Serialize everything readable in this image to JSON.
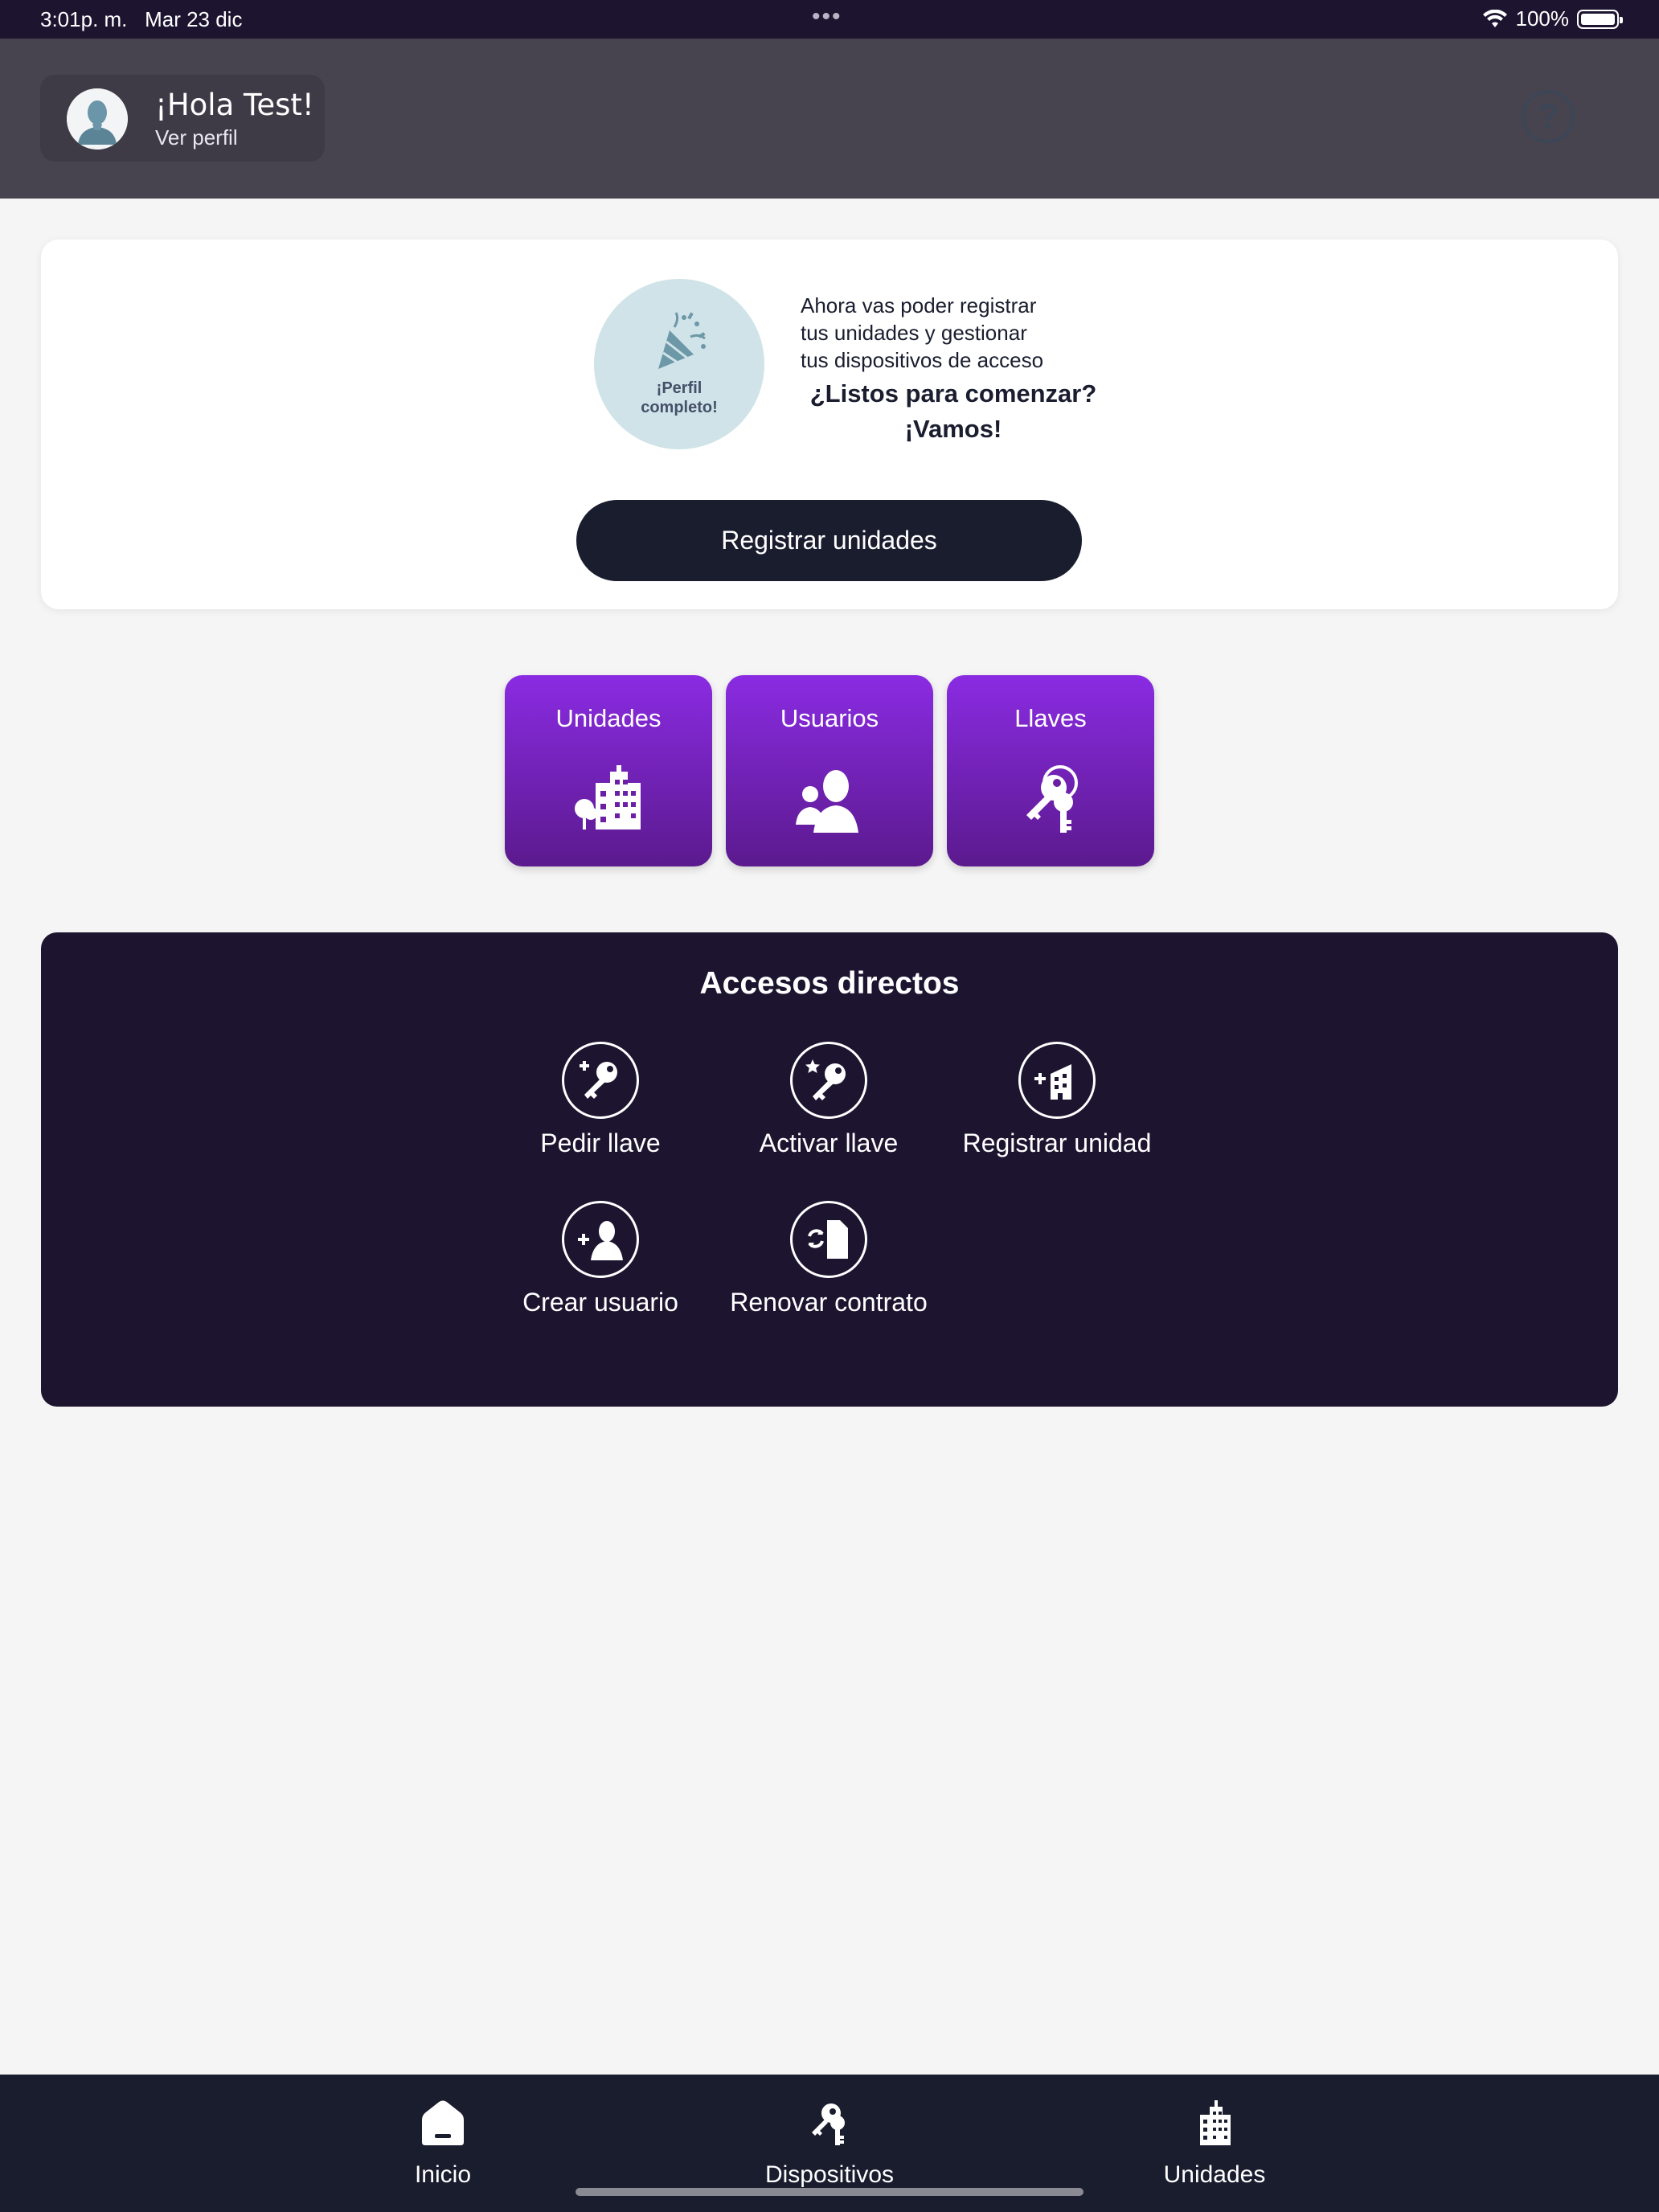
{
  "status_bar": {
    "time": "3:01p. m.",
    "date": "Mar 23 dic",
    "battery": "100%"
  },
  "header": {
    "greeting": "¡Hola Test!",
    "view_profile": "Ver perfil"
  },
  "promo": {
    "badge_line1": "¡Perfil",
    "badge_line2": "completo!",
    "text_line1": "Ahora vas poder registrar",
    "text_line2": "tus unidades y gestionar",
    "text_line3": "tus dispositivos de acceso",
    "question": "¿Listos para comenzar?",
    "go": "¡Vamos!",
    "button": "Registrar unidades"
  },
  "tiles": [
    {
      "label": "Unidades",
      "icon": "building-icon"
    },
    {
      "label": "Usuarios",
      "icon": "users-icon"
    },
    {
      "label": "Llaves",
      "icon": "keys-icon"
    }
  ],
  "shortcuts": {
    "title": "Accesos directos",
    "items": [
      {
        "label": "Pedir llave",
        "icon": "add-key-icon"
      },
      {
        "label": "Activar llave",
        "icon": "activate-key-icon"
      },
      {
        "label": "Registrar unidad",
        "icon": "add-building-icon"
      },
      {
        "label": "Crear usuario",
        "icon": "add-user-icon"
      },
      {
        "label": "Renovar contrato",
        "icon": "renew-contract-icon"
      }
    ]
  },
  "tabbar": {
    "items": [
      {
        "label": "Inicio",
        "icon": "home-icon"
      },
      {
        "label": "Dispositivos",
        "icon": "key-icon"
      },
      {
        "label": "Unidades",
        "icon": "building-icon"
      }
    ]
  },
  "colors": {
    "primary_dark": "#1a1d2e",
    "tile_purple_top": "#8a2be2",
    "tile_purple_bottom": "#5b1a8e",
    "shortcuts_bg": "#1d1530",
    "header_bg": "#47444f",
    "badge_bg": "#cfe3e8"
  }
}
